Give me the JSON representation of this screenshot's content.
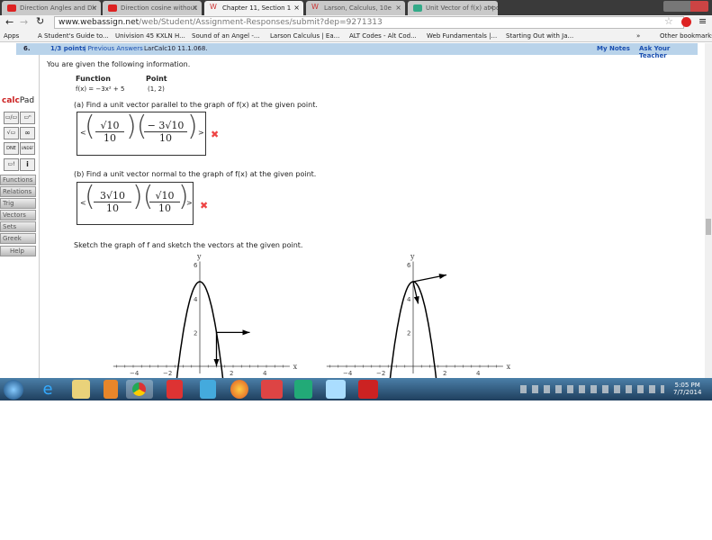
{
  "browser": {
    "tabs": [
      {
        "label": "Direction Angles and Dir",
        "icon": "youtube-icon"
      },
      {
        "label": "Direction cosine without",
        "icon": "youtube-icon"
      },
      {
        "label": "Chapter 11, Section 1",
        "icon": "webassign-icon"
      },
      {
        "label": "Larson, Calculus, 10e",
        "icon": "webassign-icon"
      },
      {
        "label": "Unit Vector of f(x) at point",
        "icon": "site-icon"
      }
    ],
    "url_host": "www.webassign.net",
    "url_path": "/web/Student/Assignment-Responses/submit?dep=9271313",
    "bookmarks": [
      "Apps",
      "A Student's Guide to...",
      "Univision 45 KXLN H...",
      "Sound of an Angel -...",
      "Larson Calculus | Ea...",
      "ALT Codes - Alt Cod...",
      "Web Fundamentals |...",
      "Starting Out with Ja..."
    ],
    "more": "»",
    "other_bookmarks": "Other bookmarks"
  },
  "question": {
    "number": "6.",
    "points": "1/3 points",
    "previous": "| Previous Answers",
    "ref": "LarCalc10 11.1.068.",
    "my_notes": "My Notes",
    "ask": "Ask Your Teacher",
    "intro": "You are given the following information.",
    "col_function": "Function",
    "col_point": "Point",
    "function": "f(x) = −3x² + 5",
    "point": "(1, 2)",
    "part_a": "(a) Find a unit vector parallel to the graph of f(x) at the given point.",
    "a_x_num": "√10",
    "a_x_den": "10",
    "a_y_num": "− 3√10",
    "a_y_den": "10",
    "part_b": "(b) Find a unit vector normal to the graph of f(x) at the given point.",
    "b_x_num": "3√10",
    "b_x_den": "10",
    "b_y_num": "√10",
    "b_y_den": "10",
    "lt": "<",
    "gt": ">",
    "wrong": "✖",
    "sketch": "Sketch the graph of f and sketch the vectors at the given point."
  },
  "calcpad": {
    "title_a": "calc",
    "title_b": "Pad",
    "buttons": [
      "Functions",
      "Relations",
      "Trig",
      "Vectors",
      "Sets",
      "Greek"
    ],
    "help": "Help",
    "keys": [
      "▭/▭",
      "▭ⁿ",
      "√▭",
      "∞",
      "DNE",
      "UNDEF",
      "▭!",
      "i"
    ]
  },
  "graph": {
    "xlabel": "x",
    "ylabel": "y",
    "xticks": [
      "−4",
      "−2",
      "2",
      "4"
    ],
    "yticks": [
      "2",
      "4",
      "6"
    ]
  },
  "taskbar": {
    "time": "5:05 PM",
    "date": "7/7/2014"
  }
}
